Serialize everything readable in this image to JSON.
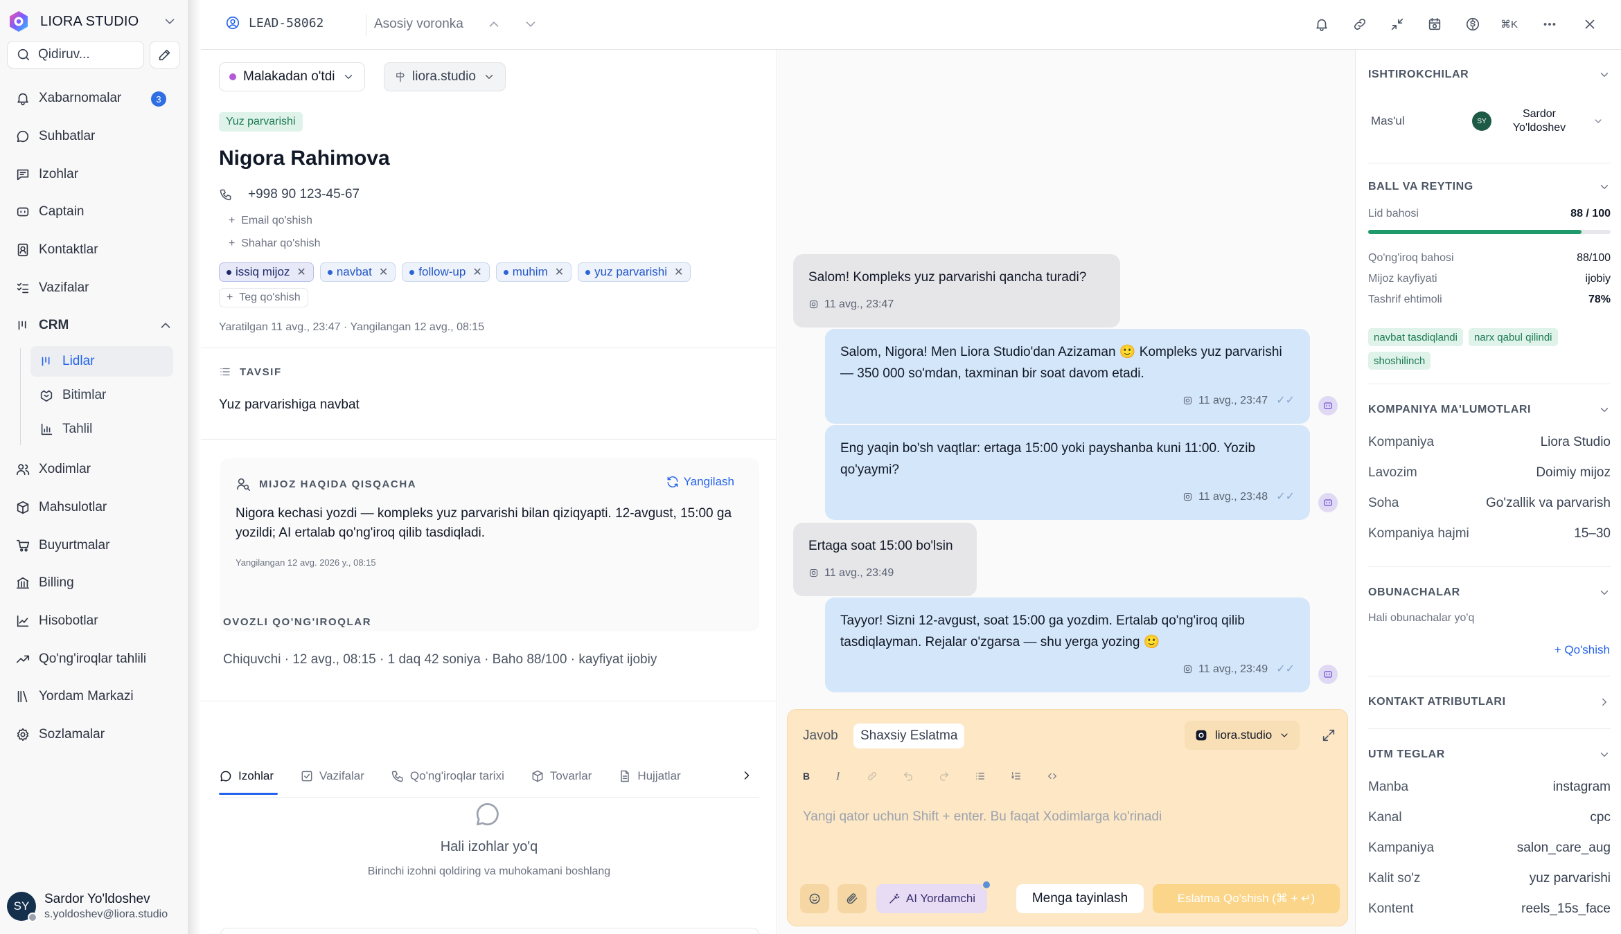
{
  "app": {
    "name": "LIORA STUDIO",
    "search_placeholder": "Qidiruv..."
  },
  "sidebar": {
    "items": [
      {
        "label": "Xabarnomalar",
        "icon": "bell-icon",
        "badge": "3"
      },
      {
        "label": "Suhbatlar",
        "icon": "chat-icon"
      },
      {
        "label": "Izohlar",
        "icon": "notes-icon"
      },
      {
        "label": "Captain",
        "icon": "captain-icon"
      },
      {
        "label": "Kontaktlar",
        "icon": "contacts-icon"
      },
      {
        "label": "Vazifalar",
        "icon": "tasks-icon"
      },
      {
        "label": "CRM",
        "icon": "crm-icon"
      },
      {
        "label": "Xodimlar",
        "icon": "users-icon"
      },
      {
        "label": "Mahsulotlar",
        "icon": "box-icon"
      },
      {
        "label": "Buyurtmalar",
        "icon": "cart-icon"
      },
      {
        "label": "Billing",
        "icon": "bank-icon"
      },
      {
        "label": "Hisobotlar",
        "icon": "chart-icon"
      },
      {
        "label": "Qo'ng'iroqlar tahlili",
        "icon": "trend-icon"
      },
      {
        "label": "Yordam Markazi",
        "icon": "library-icon"
      },
      {
        "label": "Sozlamalar",
        "icon": "gear-icon"
      }
    ],
    "crm_sub": [
      {
        "label": "Lidlar"
      },
      {
        "label": "Bitimlar"
      },
      {
        "label": "Tahlil"
      }
    ],
    "user": {
      "initials": "SY",
      "name": "Sardor Yo'ldoshev",
      "email": "s.yoldoshev@liora.studio"
    }
  },
  "topbar": {
    "lead_id": "LEAD-58062",
    "funnel": "Asosiy voronka",
    "shortcut": "⌘K"
  },
  "lead": {
    "status": "Malakadan o'tdi",
    "domain": "liora.studio",
    "category": "Yuz parvarishi",
    "name": "Nigora Rahimova",
    "phone": "+998 90 123-45-67",
    "add_email": "Email qo'shish",
    "add_city": "Shahar qo'shish",
    "tags": [
      "issiq mijoz",
      "navbat",
      "follow-up",
      "muhim",
      "yuz parvarishi"
    ],
    "add_tag": "Teg qo'shish",
    "meta": "Yaratilgan 11 avg., 23:47 · Yangilangan 12 avg., 08:15",
    "desc_title": "TAVSIF",
    "desc": "Yuz parvarishiga navbat",
    "summary_title": "MIJOZ HAQIDA QISQACHA",
    "refresh": "Yangilash",
    "summary": "Nigora kechasi yozdi — kompleks yuz parvarishi bilan qiziqyapti. 12-avgust, 15:00 ga yozildi; AI ertalab qo'ng'iroq qilib tasdiqladi.",
    "summary_updated": "Yangilangan 12 avg. 2026 y., 08:15",
    "calls_title": "OVOZLI QO'NG'IROQLAR",
    "call_row": "Chiquvchi · 12 avg., 08:15 · 1 daq 42 soniya · Baho 88/100 · kayfiyat ijobiy",
    "tabs": [
      "Izohlar",
      "Vazifalar",
      "Qo'ng'iroqlar tarixi",
      "Tovarlar",
      "Hujjatlar"
    ],
    "empty_title": "Hali izohlar yo'q",
    "empty_sub": "Birinchi izohni qoldiring va muhokamani boshlang"
  },
  "chat": {
    "messages": [
      {
        "dir": "in",
        "text": "Salom! Kompleks yuz parvarishi qancha turadi?",
        "time": "11 avg., 23:47"
      },
      {
        "dir": "out",
        "text": "Salom, Nigora! Men Liora Studio'dan Azizaman 🙂 Kompleks yuz parvarishi — 350 000 so'mdan, taxminan bir soat davom etadi.",
        "time": "11 avg., 23:47"
      },
      {
        "dir": "out",
        "text": "Eng yaqin bo'sh vaqtlar: ertaga 15:00 yoki payshanba kuni 11:00. Yozib qo'yaymi?",
        "time": "11 avg., 23:48"
      },
      {
        "dir": "in",
        "text": "Ertaga soat 15:00 bo'lsin",
        "time": "11 avg., 23:49"
      },
      {
        "dir": "out",
        "text": "Tayyor! Sizni 12-avgust, soat 15:00 ga yozdim. Ertalab qo'ng'iroq qilib tasdiqlayman. Rejalar o'zgarsa — shu yerga yozing 🙂",
        "time": "11 avg., 23:49"
      }
    ],
    "composer": {
      "tab_reply": "Javob",
      "tab_note": "Shaxsiy Eslatma",
      "channel": "liora.studio",
      "placeholder": "Yangi qator uchun Shift + enter. Bu faqat Xodimlarga ko'rinadi",
      "ai": "AI Yordamchi",
      "assign": "Menga tayinlash",
      "submit": "Eslatma Qo'shish (⌘ + ↵)"
    }
  },
  "right": {
    "participants": {
      "title": "ISHTIROKCHILAR",
      "owner_label": "Mas'ul",
      "owner_initials": "SY",
      "owner_name": "Sardor Yo'ldoshev"
    },
    "score": {
      "title": "BALL VA REYTING",
      "lead_label": "Lid bahosi",
      "lead_value": "88 / 100",
      "lead_fraction": 0.88,
      "rows": [
        {
          "k": "Qo'ng'iroq bahosi",
          "v": "88/100"
        },
        {
          "k": "Mijoz kayfiyati",
          "v": "ijobiy"
        },
        {
          "k": "Tashrif ehtimoli",
          "v": "78%"
        }
      ],
      "tags": [
        "navbat tasdiqlandi",
        "narx qabul qilindi",
        "shoshilinch"
      ]
    },
    "company": {
      "title": "KOMPANIYA MA'LUMOTLARI",
      "rows": [
        {
          "k": "Kompaniya",
          "v": "Liora Studio"
        },
        {
          "k": "Lavozim",
          "v": "Doimiy mijoz"
        },
        {
          "k": "Soha",
          "v": "Go'zallik va parvarish"
        },
        {
          "k": "Kompaniya hajmi",
          "v": "15–30"
        }
      ]
    },
    "subscribers": {
      "title": "OBUNACHALAR",
      "empty": "Hali obunachalar yo'q",
      "add": "+ Qo'shish"
    },
    "attributes": {
      "title": "KONTAKT ATRIBUTLARI"
    },
    "utm": {
      "title": "UTM TEGLAR",
      "rows": [
        {
          "k": "Manba",
          "v": "instagram"
        },
        {
          "k": "Kanal",
          "v": "cpc"
        },
        {
          "k": "Kampaniya",
          "v": "salon_care_aug"
        },
        {
          "k": "Kalit so'z",
          "v": "yuz parvarishi"
        },
        {
          "k": "Kontent",
          "v": "reels_15s_face"
        }
      ]
    }
  }
}
